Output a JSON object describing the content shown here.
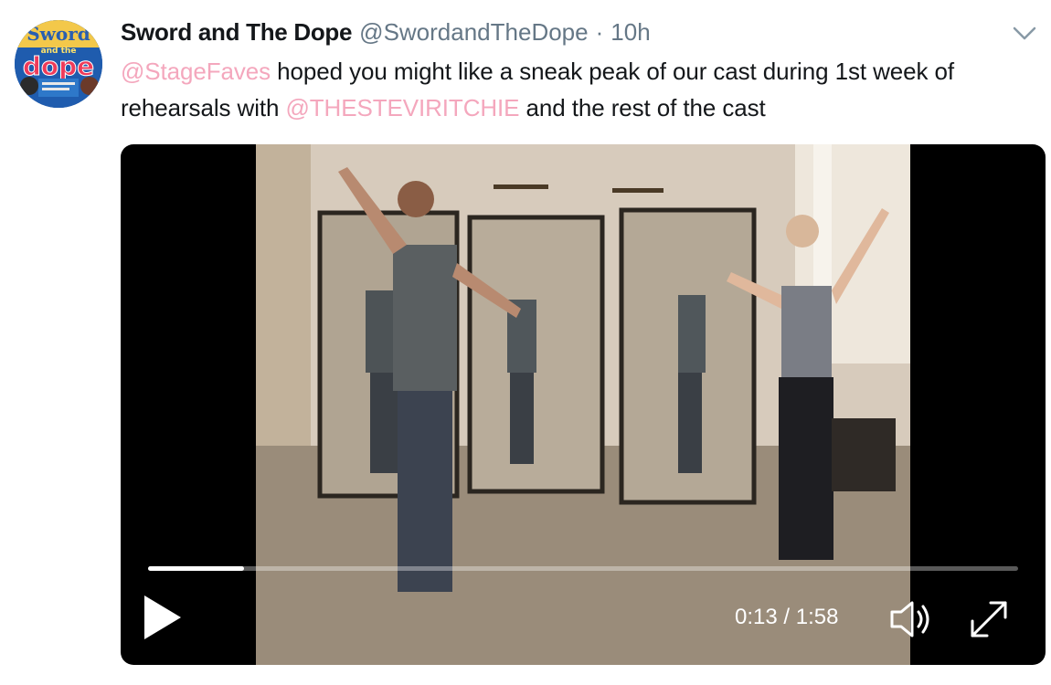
{
  "author": {
    "display_name": "Sword and The Dope",
    "handle": "@SwordandTheDope",
    "separator": "·",
    "time": "10h"
  },
  "avatar": {
    "icon": "avatar-logo",
    "line1": "Sword",
    "line2": "and the",
    "line3": "dope"
  },
  "tweet": {
    "mention1": "@StageFaves",
    "text1": " hoped you might like a sneak peak of our cast during 1st week of rehearsals with ",
    "mention2": "@THESTEVIRITCHIE",
    "text2": " and the rest of the cast"
  },
  "video": {
    "current_time": "0:13",
    "duration": "1:58",
    "time_display": "0:13 / 1:58",
    "progress": 0.11,
    "icons": {
      "play": "play-icon",
      "volume": "volume-icon",
      "fullscreen": "fullscreen-icon"
    }
  },
  "colors": {
    "mention": "#f4a7bd",
    "name": "#14171a",
    "meta": "#657786"
  }
}
